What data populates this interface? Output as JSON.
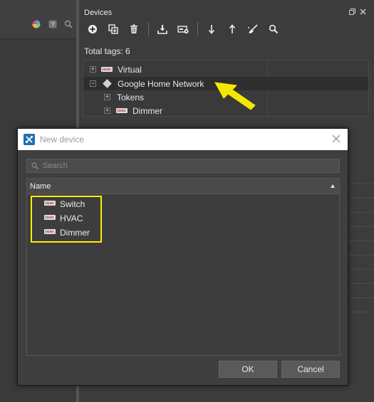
{
  "devices_panel": {
    "title": "Devices",
    "total_tags": "Total tags: 6",
    "toolbar": [
      "add-icon",
      "duplicate-icon",
      "delete-icon",
      "import-icon",
      "device-settings-icon",
      "arrow-down-icon",
      "arrow-up-icon",
      "clean-icon",
      "search-icon"
    ],
    "tree": [
      {
        "label": "Virtual",
        "icon": "tag-icon",
        "expander": "+"
      },
      {
        "label": "Google Home Network",
        "icon": "diamond-icon",
        "expander": "−"
      },
      {
        "label": "Tokens",
        "expander": "+"
      },
      {
        "label": "Dimmer",
        "icon": "tag-icon",
        "expander": "+"
      }
    ]
  },
  "dialog": {
    "title": "New device",
    "search_placeholder": "Search",
    "column_header": "Name",
    "items": [
      "Switch",
      "HVAC",
      "Dimmer"
    ],
    "ok_label": "OK",
    "cancel_label": "Cancel"
  },
  "colors": {
    "highlight": "#ffee00",
    "arrow": "#f5e800",
    "selected_row": "#2e2e2e",
    "app_icon": "#1f6fb0"
  }
}
